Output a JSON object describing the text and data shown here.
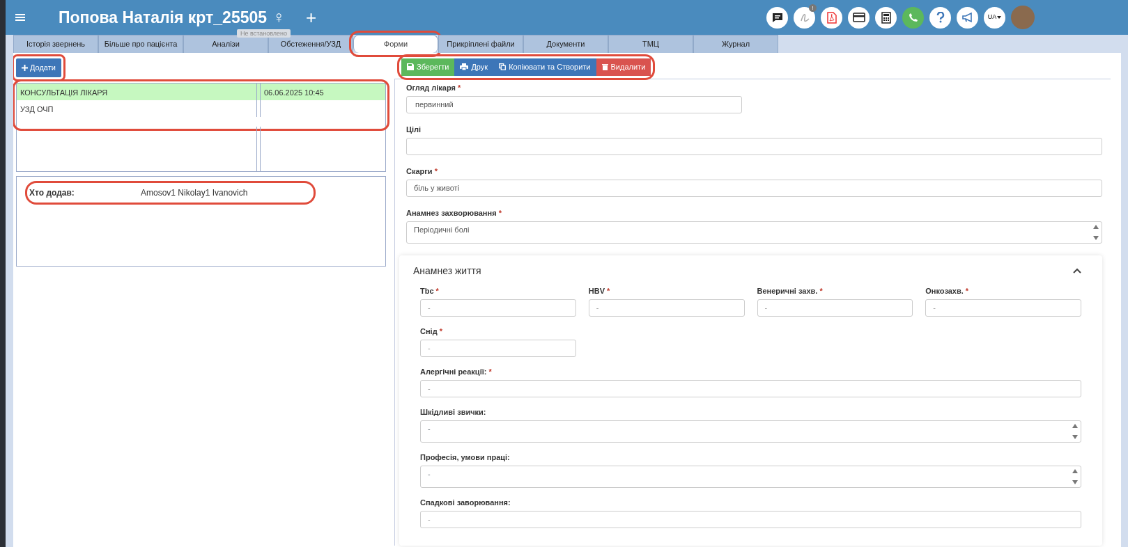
{
  "header": {
    "title": "Попова Наталія крт_25505",
    "gender_sign": "♀",
    "add_label": "+",
    "tooltip": "Не встановлено",
    "language": "UA",
    "icons": [
      {
        "kind": "chat"
      },
      {
        "kind": "signature",
        "badge": "!"
      },
      {
        "kind": "pdf"
      },
      {
        "kind": "card"
      },
      {
        "kind": "calculator"
      },
      {
        "kind": "phone"
      },
      {
        "kind": "help"
      },
      {
        "kind": "megaphone"
      }
    ]
  },
  "tabs": [
    {
      "label": "Історія звернень",
      "selected": false,
      "highlighted": false
    },
    {
      "label": "Більше про пацієнта",
      "selected": false,
      "highlighted": false
    },
    {
      "label": "Аналізи",
      "selected": false,
      "highlighted": false
    },
    {
      "label": "Обстеження/УЗД",
      "selected": false,
      "highlighted": false
    },
    {
      "label": "Форми",
      "selected": true,
      "highlighted": true
    },
    {
      "label": "Прикріплені файли",
      "selected": false,
      "highlighted": false
    },
    {
      "label": "Документи",
      "selected": false,
      "highlighted": false
    },
    {
      "label": "ТМЦ",
      "selected": false,
      "highlighted": false
    },
    {
      "label": "Журнал",
      "selected": false,
      "highlighted": false
    }
  ],
  "add_button": {
    "label": "Додати",
    "highlighted": true
  },
  "records": {
    "highlighted": true,
    "rows": [
      {
        "name": "КОНСУЛЬТАЦІЯ ЛІКАРЯ",
        "date": "06.06.2025 10:45",
        "selected": true
      },
      {
        "name": "УЗД ОЧП",
        "selected": false
      }
    ]
  },
  "author": {
    "label": "Хто додав:",
    "value": "Amosov1 Nikolay1 Ivanovich",
    "highlighted": true
  },
  "toolbar": {
    "highlighted": true,
    "buttons": [
      {
        "label": "Зберегти",
        "kind": "save"
      },
      {
        "label": "Друк",
        "kind": "print"
      },
      {
        "label": "Копіювати та Створити",
        "kind": "copy"
      },
      {
        "label": "Видалити",
        "kind": "delete"
      }
    ]
  },
  "form": {
    "fields": [
      {
        "label": "Огляд лікаря",
        "mark": "*",
        "kind": "select",
        "value": "первинний"
      },
      {
        "label": "Цілі",
        "kind": "input"
      },
      {
        "label": "Скарги",
        "mark": "*",
        "kind": "input",
        "value": "біль у животі"
      },
      {
        "label": "Анамнез захворювання",
        "mark": "*",
        "kind": "textarea",
        "value": "Періодичні болі"
      }
    ],
    "section": {
      "title": "Анамнез життя",
      "expanded": true,
      "fields": [
        {
          "label": "Tbc",
          "mark": "*",
          "kind": "short",
          "placeholder": "-"
        },
        {
          "label": "HBV",
          "mark": "*",
          "kind": "short",
          "placeholder": "-"
        },
        {
          "label": "Венеричні захв.",
          "mark": "*",
          "kind": "short",
          "placeholder": "-"
        },
        {
          "label": "Онкозахв.",
          "mark": "*",
          "kind": "short",
          "placeholder": "-"
        },
        {
          "label": "Снід",
          "mark": "*",
          "kind": "short",
          "placeholder": "-"
        },
        {
          "label": "Алергічні реакції:",
          "mark": "*",
          "kind": "input",
          "placeholder": "-"
        },
        {
          "label": "Шкідливі звички:",
          "kind": "textarea",
          "placeholder": "-"
        },
        {
          "label": "Професія, умови праці:",
          "kind": "textarea",
          "placeholder": "-"
        },
        {
          "label": "Спадкові заворювання:",
          "kind": "input",
          "placeholder": "-"
        }
      ]
    }
  }
}
